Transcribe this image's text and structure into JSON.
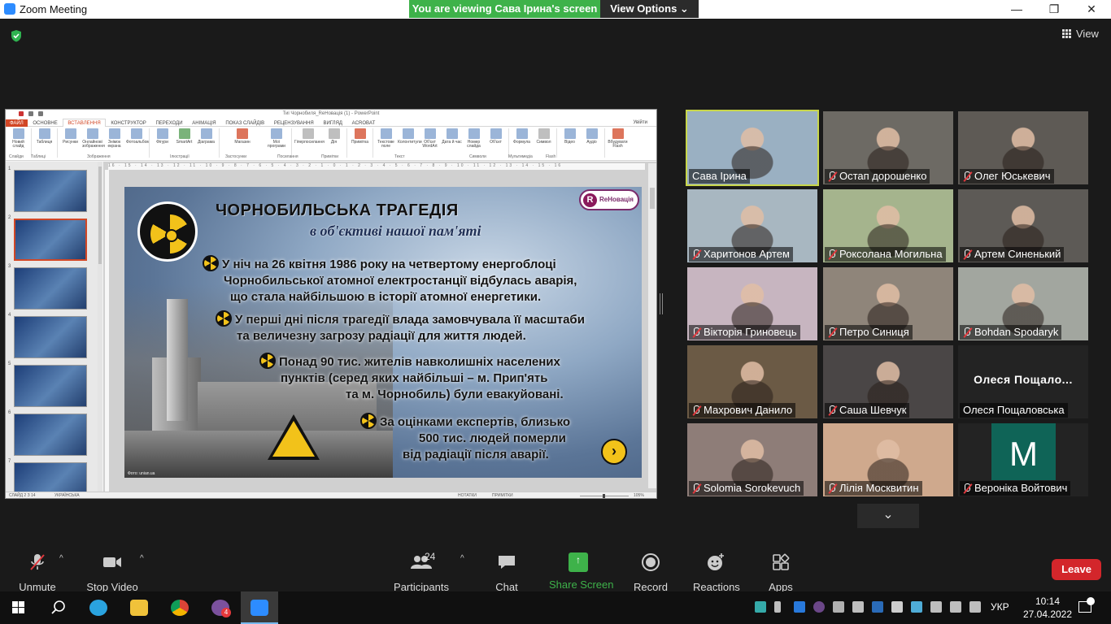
{
  "window": {
    "title": "Zoom Meeting",
    "min": "—",
    "restore": "❐",
    "close": "✕"
  },
  "banner": {
    "viewing": "You are viewing Сава Ірина's screen",
    "view_options": "View Options ⌄"
  },
  "view_label": "View",
  "ppt": {
    "title": "Тиі Чорнобиля_ReНовація (1) - PowerPoint",
    "tabs": [
      "ФАЙЛ",
      "ОСНОВНЕ",
      "ВСТАВЛЕННЯ",
      "КОНСТРУКТОР",
      "ПЕРЕХОДИ",
      "АНІМАЦІЯ",
      "ПОКАЗ СЛАЙДІВ",
      "РЕЦЕНЗУВАННЯ",
      "ВИГЛЯД",
      "ACROBAT"
    ],
    "login": "Увійти",
    "ribbon": [
      "Новий слайд",
      "Таблиця",
      "Рисунки",
      "Онлайнові зображення",
      "Знімок екрана",
      "Фотоальбом",
      "Фігури",
      "SmartArt",
      "Діаграма",
      "Магазин",
      "Мої програми",
      "Гіперпосилання",
      "Дія",
      "Примітка",
      "Текстове поле",
      "Колонтитули",
      "Об'єкт WordArt",
      "Дата й час",
      "Номер слайда",
      "Об'єкт",
      "Формула",
      "Символ",
      "Відео",
      "Аудіо",
      "Вбудувати Flash"
    ],
    "groups": [
      "Слайди",
      "Таблиці",
      "Зображення",
      "Ілюстрації",
      "Застосунки",
      "Посилання",
      "Примітки",
      "Текст",
      "Символи",
      "Мультимедіа",
      "Flash"
    ],
    "ruler": "16 · 15 · 14 · 13 · 12 · 11 · 10 · 9 · 8 · 7 · 6 · 5 · 4 · 3 · 2 · 1 · 0 · 1 · 2 · 3 · 4 · 5 · 6 · 7 · 8 · 9 · 10 · 11 · 12 · 13 · 14 · 15 · 16",
    "thumb_numbers": [
      "1",
      "2",
      "3",
      "4",
      "5",
      "6",
      "7"
    ],
    "status": {
      "slide": "СЛАЙД 2 З 14",
      "lang": "УКРАЇНСЬКА",
      "notes": "НОТАТКИ",
      "comments": "ПРИМІТКИ",
      "zoom": "105%"
    }
  },
  "slide": {
    "title": "ЧОРНОБИЛЬСЬКА ТРАГЕДІЯ",
    "subtitle": "в об'єктиві нашої пам'яті",
    "brand": "ReНовація",
    "brand_letter": "R",
    "bullets": [
      [
        "У ніч на 26 квітня 1986 року на четвертому енергоблоці",
        "Чорнобильської атомної електростанції відбулась аварія,",
        "що стала найбільшою в історії атомної енергетики."
      ],
      [
        "У перші дні після трагедії влада замовчувала її масштаби",
        "та величезну загрозу радіації для життя людей."
      ],
      [
        "Понад 90 тис. жителів навколишніх населених",
        "пунктів (серед яких найбільші – м. Прип'ять",
        "та м. Чорнобиль) були евакуйовані."
      ],
      [
        "За оцінками експертів, близько",
        "500 тис. людей померли",
        "від радіації після аварії."
      ]
    ],
    "credit": "Фото: unian.ua",
    "next": "›"
  },
  "participants": [
    {
      "name": "Сава Ірина",
      "muted": false,
      "speaker": true,
      "bg": "#9ab0c2"
    },
    {
      "name": "Остап дорошенко",
      "muted": true,
      "bg": "#6d6a64"
    },
    {
      "name": "Олег Юськевич",
      "muted": true,
      "bg": "#5e5a55"
    },
    {
      "name": "Харитонов Артем",
      "muted": true,
      "bg": "#a8b7c1"
    },
    {
      "name": "Роксолана Могильна",
      "muted": true,
      "bg": "#a5b48d"
    },
    {
      "name": "Артем Синенький",
      "muted": true,
      "bg": "#5d5a56"
    },
    {
      "name": "Вікторія Гриновець",
      "muted": true,
      "bg": "#c7b5c0"
    },
    {
      "name": "Петро Синиця",
      "muted": true,
      "bg": "#8f857a"
    },
    {
      "name": "Bohdan Spodaryk",
      "muted": true,
      "bg": "#a2a69f"
    },
    {
      "name": "Махрович Данило",
      "muted": true,
      "bg": "#6b5a45"
    },
    {
      "name": "Саша Шевчук",
      "muted": true,
      "bg": "#4a4646"
    },
    {
      "name": "Олеся Пощаловська",
      "muted": false,
      "bg": "#232323",
      "big": "Олеся  Пощало..."
    },
    {
      "name": "Solomia Sorokevuch",
      "muted": true,
      "bg": "#8e7d78"
    },
    {
      "name": "Лілія Москвитин",
      "muted": true,
      "bg": "#cfa98d"
    },
    {
      "name": "Вероніка Войтович",
      "muted": true,
      "bg": "#232323",
      "avatar": "M"
    }
  ],
  "more": "⌄",
  "toolbar": {
    "unmute": "Unmute",
    "stop_video": "Stop Video",
    "participants": "Participants",
    "participants_count": "24",
    "chat": "Chat",
    "share": "Share Screen",
    "record": "Record",
    "reactions": "Reactions",
    "apps": "Apps",
    "leave": "Leave",
    "caret": "^",
    "share_arrow": "↑"
  },
  "taskbar": {
    "lang": "УКР",
    "time": "10:14",
    "date": "27.04.2022",
    "viber_badge": "4"
  }
}
